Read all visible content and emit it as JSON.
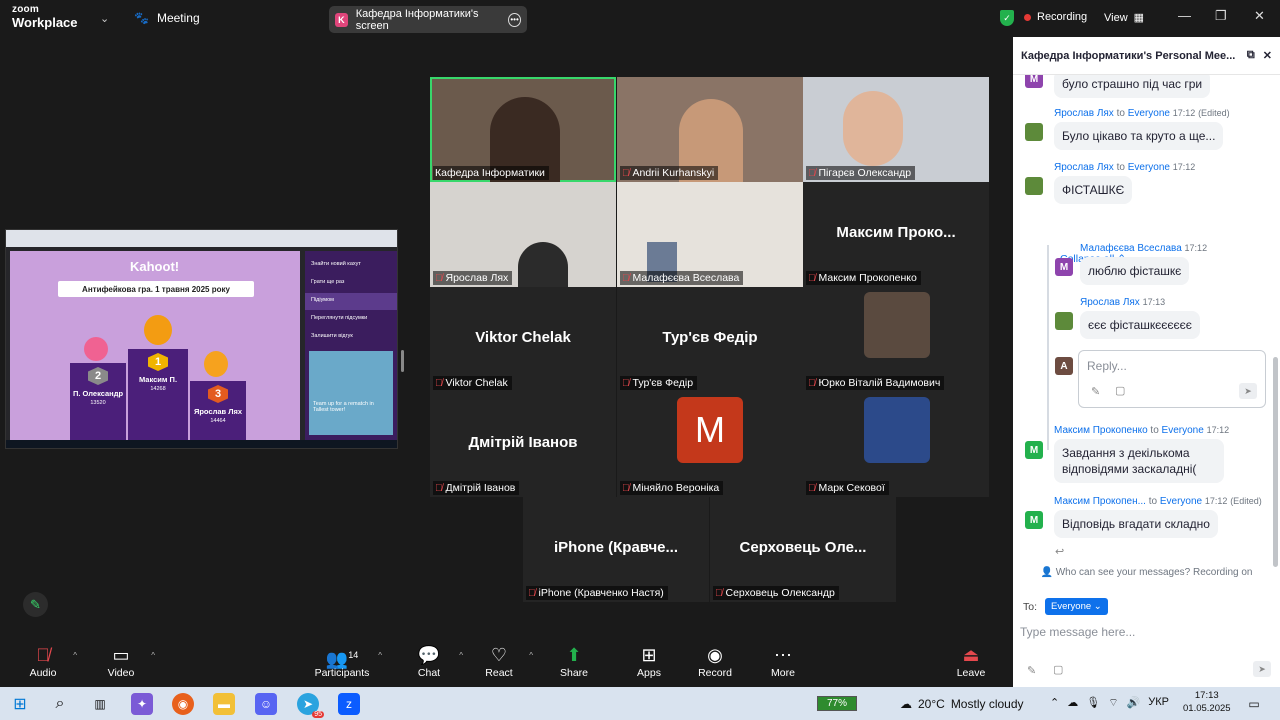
{
  "topbar": {
    "brand_top": "zoom",
    "brand_bottom": "Workplace",
    "meeting_label": "Meeting",
    "share_initial": "K",
    "share_label": "Кафедра Інформатики's screen",
    "recording_label": "Recording",
    "view_label": "View",
    "secure_color": "#23b14d"
  },
  "shared_screen": {
    "brand": "Kahoot!",
    "banner": "Антифейкова гра. 1 травня 2025 року",
    "podium": [
      {
        "rank": "2",
        "name": "П. Олександр",
        "score": "13520"
      },
      {
        "rank": "1",
        "name": "Максим П.",
        "score": "14268"
      },
      {
        "rank": "3",
        "name": "Ярослав Лях",
        "score": "14464"
      }
    ],
    "side_items": [
      "Знайти новий кахут",
      "Грати ще раз",
      "Підіумом",
      "Переглянути підсумки",
      "Залишити відгук"
    ],
    "promo_text": "Team up for a rematch in Tallest tower!"
  },
  "participants_grid": [
    {
      "name": "Кафедра Інформатики",
      "video": true,
      "active": true
    },
    {
      "name": "Andrii Kurhanskyi",
      "video": true
    },
    {
      "name": "Пігарєв Олександр",
      "video": true
    },
    {
      "name": "Ярослав Лях",
      "video": true
    },
    {
      "name": "Малафєєва Всеслава",
      "video": true
    },
    {
      "name": "Максим Прокопенко",
      "display": "Максим Проко..."
    },
    {
      "name": "Viktor Chelak",
      "display": "Viktor Chelak"
    },
    {
      "name": "Тур'єв Федір",
      "display": "Тур'єв Федір"
    },
    {
      "name": "Юрко Віталій Вадимович",
      "avatar": "photo"
    },
    {
      "name": "Дмітрій Іванов",
      "display": "Дмітрій Іванов"
    },
    {
      "name": "Міняйло Вероніка",
      "avatar": "M"
    },
    {
      "name": "Марк Секової",
      "avatar": "art"
    },
    {
      "name": "iPhone (Кравченко Настя)",
      "display": "iPhone (Кравче..."
    },
    {
      "name": "Серховець Олександр",
      "display": "Серховець Оле..."
    }
  ],
  "chat": {
    "title": "Кафедра Інформатики's Personal Mee...",
    "messages": [
      {
        "avatar": "M",
        "color": "#8e44ad",
        "text": "було страшно під час гри"
      },
      {
        "sender": "Ярослав Лях",
        "to": "to",
        "recipient": "Everyone",
        "time": "17:12",
        "note": "(Edited)",
        "avatar": "img",
        "text": "Було цікаво та круто а ще..."
      },
      {
        "sender": "Ярослав Лях",
        "to": "to",
        "recipient": "Everyone",
        "time": "17:12",
        "avatar": "img",
        "text": "ФІСТАШКЄ"
      },
      {
        "sender": "Малафєєва Всеслава",
        "time": "17:12",
        "avatar": "M",
        "color": "#8e44ad",
        "text": "люблю фісташкє"
      },
      {
        "sender": "Ярослав Лях",
        "time": "17:13",
        "avatar": "img",
        "text": "єєє фісташкєєєєєє"
      },
      {
        "sender": "Максим Прокопенко",
        "to": "to",
        "recipient": "Everyone",
        "time": "17:12",
        "avatar": "M",
        "color": "#23b14d",
        "text": "Завдання з декількома відповідями заскаладні("
      },
      {
        "sender": "Максим Прокопен...",
        "to": "to",
        "recipient": "Everyone",
        "time": "17:12",
        "note": "(Edited)",
        "avatar": "M",
        "color": "#23b14d",
        "text": "Відповідь вгадати складно"
      }
    ],
    "collapse_label": "Collapse all",
    "reply_avatar": "A",
    "reply_placeholder": "Reply...",
    "visibility_note": "Who can see your messages? Recording on",
    "to_label": "To:",
    "to_value": "Everyone",
    "compose_placeholder": "Type message here..."
  },
  "toolbar": {
    "audio": "Audio",
    "video": "Video",
    "participants_count": "14",
    "participants": "Participants",
    "chat": "Chat",
    "react": "React",
    "share": "Share",
    "apps": "Apps",
    "record": "Record",
    "more": "More",
    "leave": "Leave"
  },
  "taskbar": {
    "battery": "77%",
    "temperature": "20°C",
    "weather": "Mostly cloudy",
    "language": "УКР",
    "time": "17:13",
    "date": "01.05.2025",
    "telegram_badge": "95"
  }
}
